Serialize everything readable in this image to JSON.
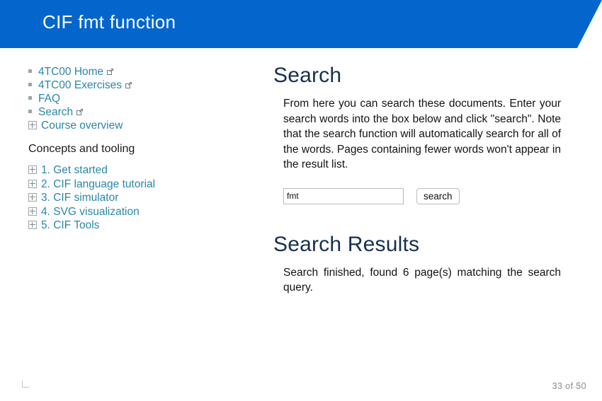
{
  "slide": {
    "title": "CIF fmt function",
    "header_color": "#0466cc",
    "page_indicator": "33 of 50"
  },
  "sidebar": {
    "nav_items": [
      {
        "label": "4TC00 Home",
        "marker": "square-bullet",
        "external": true
      },
      {
        "label": "4TC00 Exercises",
        "marker": "square-bullet",
        "external": true
      },
      {
        "label": "FAQ",
        "marker": "square-bullet",
        "external": false
      },
      {
        "label": "Search",
        "marker": "square-bullet",
        "external": true
      },
      {
        "label": "Course overview",
        "marker": "expand-plus",
        "external": false
      }
    ],
    "section_label": "Concepts and tooling",
    "tree_items": [
      {
        "label": "1. Get started",
        "marker": "expand-plus"
      },
      {
        "label": "2. CIF language tutorial",
        "marker": "expand-plus"
      },
      {
        "label": "3. CIF simulator",
        "marker": "expand-plus"
      },
      {
        "label": "4. SVG visualization",
        "marker": "expand-plus"
      },
      {
        "label": "5. CIF Tools",
        "marker": "expand-plus"
      }
    ],
    "link_color": "#2a86a8"
  },
  "main": {
    "heading": "Search",
    "intro_paragraph": "From here you can search these documents. Enter your search words into the box below and click \"search\". Note that the search function will automatically search for all of the words. Pages containing fewer words won't appear in the result list.",
    "search_field_value": "fmt",
    "search_field_placeholder": "",
    "search_button_label": "search",
    "results_heading": "Search Results",
    "results_message": "Search finished, found 6 page(s) matching the search query.",
    "heading_color": "#17304f"
  }
}
